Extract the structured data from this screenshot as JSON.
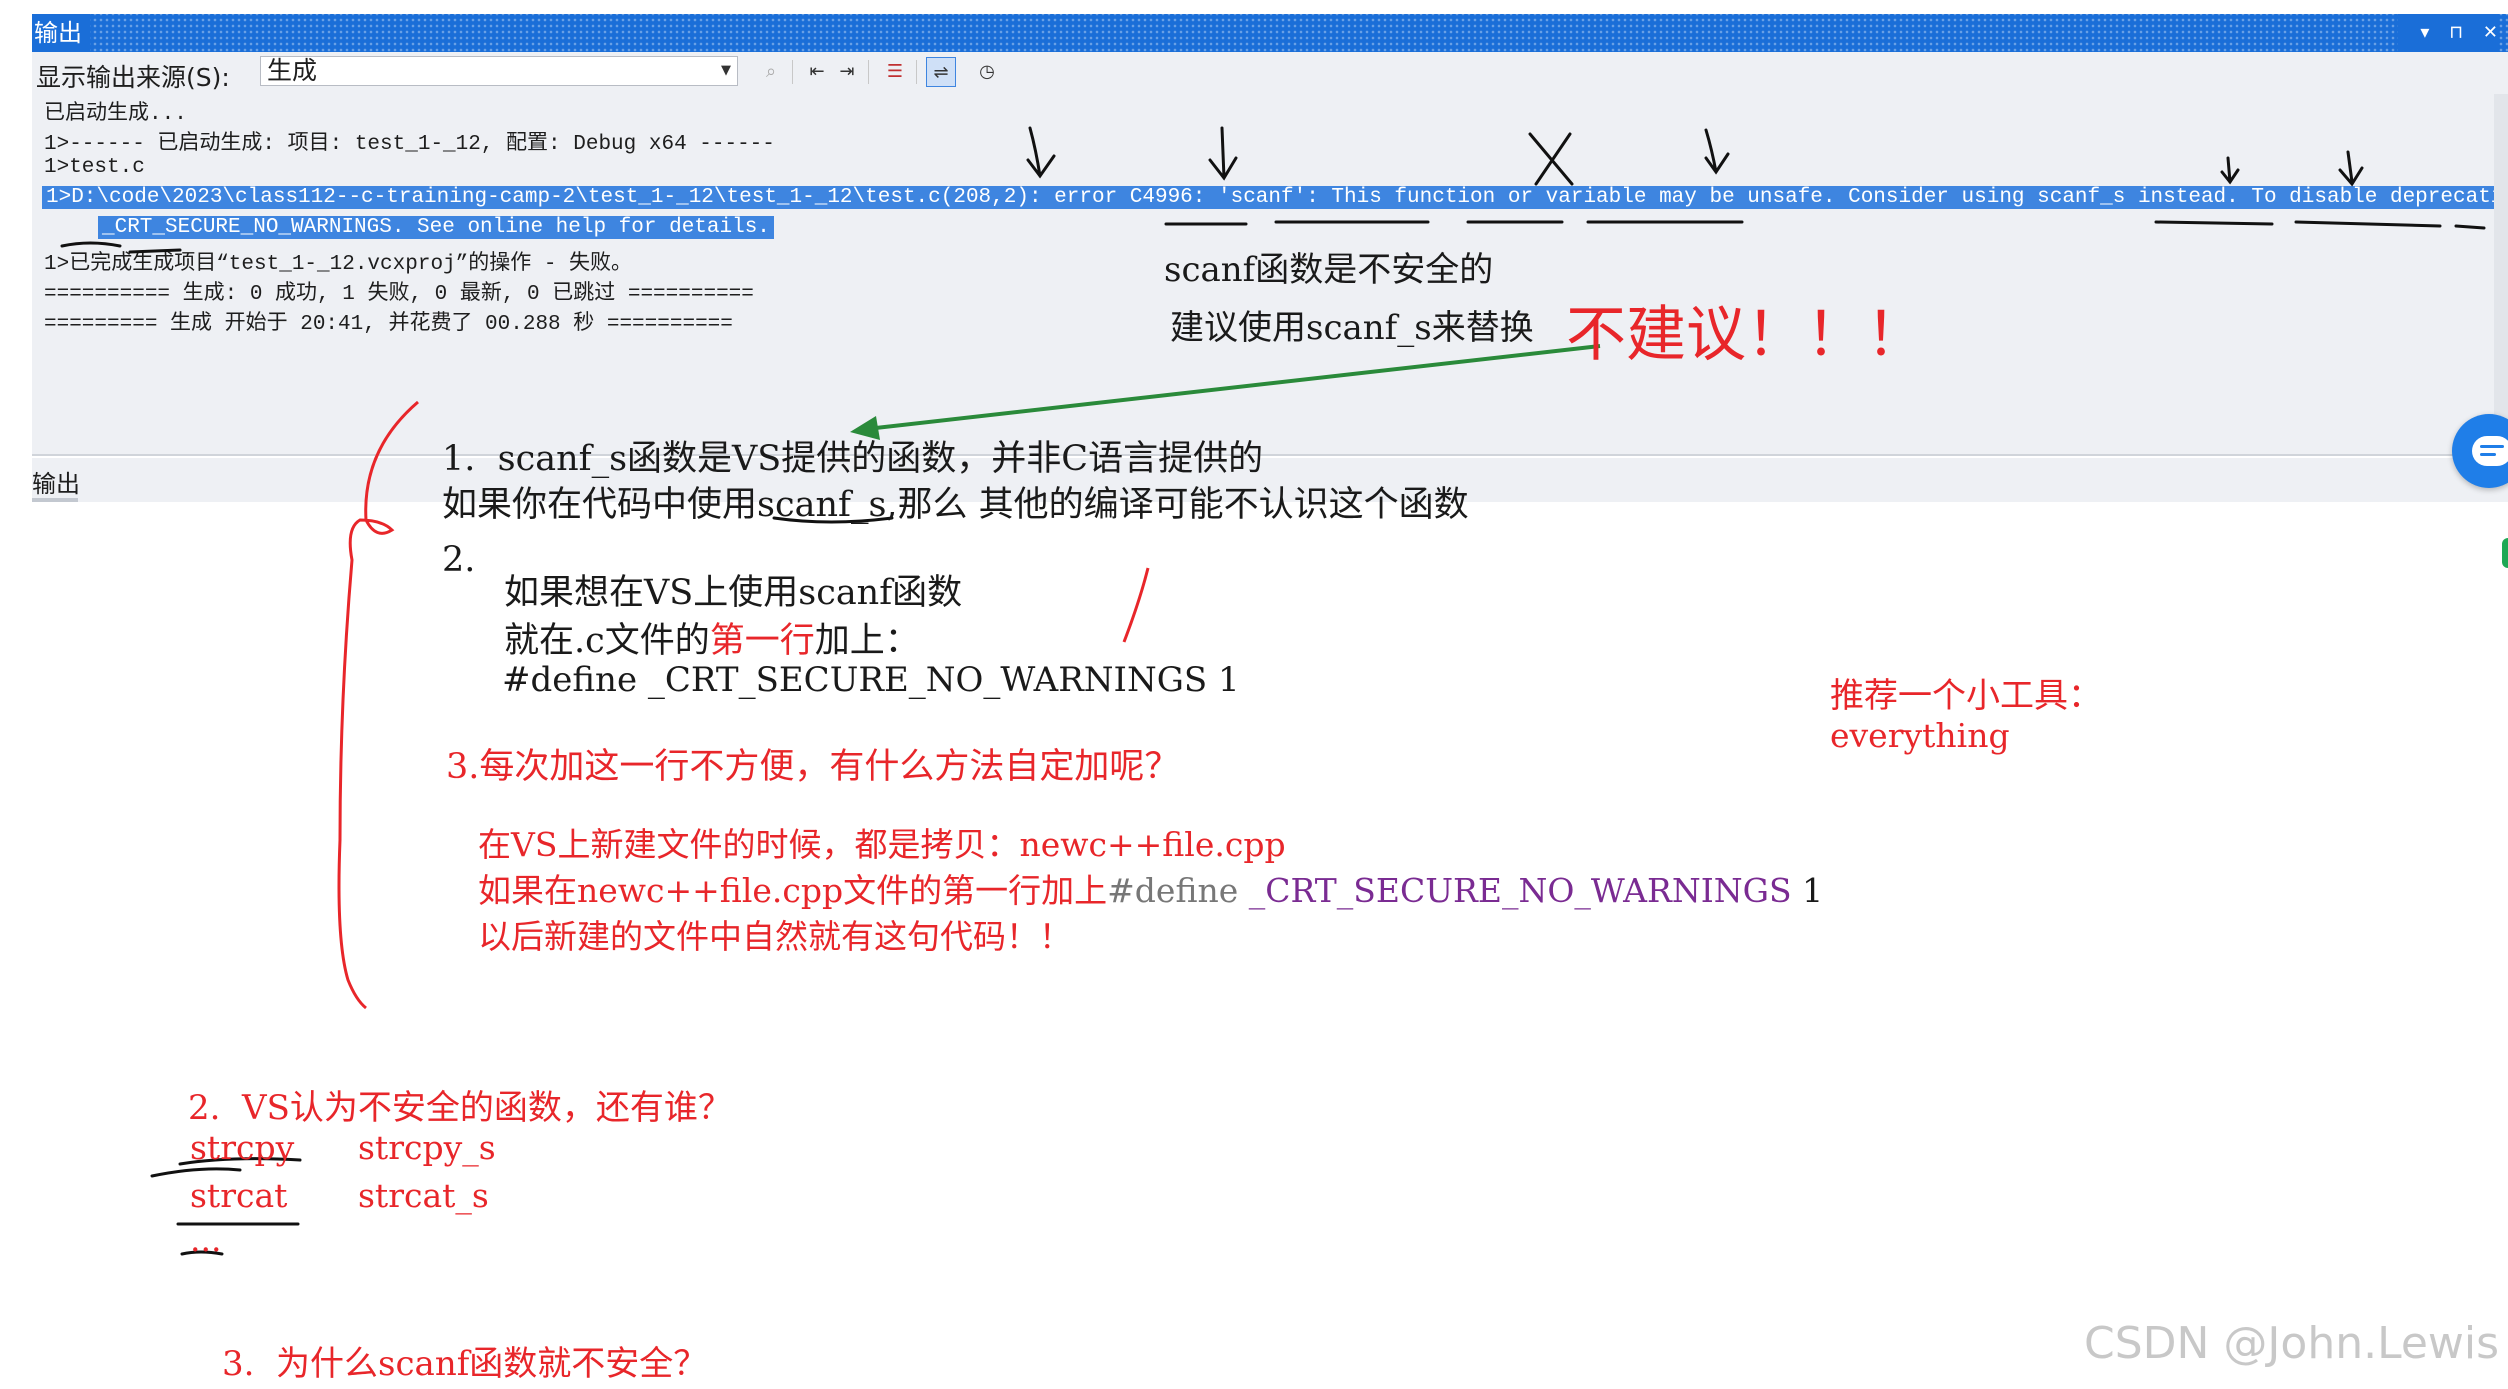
{
  "window": {
    "title": "输出",
    "controls": [
      "▾",
      "⊓",
      "✕"
    ]
  },
  "toolbar": {
    "source_label": "显示输出来源(S):",
    "source_value": "生成",
    "buttons": [
      {
        "icon": "find-message-icon",
        "glyph": "⌕"
      },
      {
        "icon": "prev-message-icon",
        "glyph": "⇤"
      },
      {
        "icon": "next-message-icon",
        "glyph": "⇥"
      },
      {
        "icon": "clear-all-icon",
        "glyph": "☰"
      },
      {
        "icon": "word-wrap-icon",
        "glyph": "⇌"
      },
      {
        "icon": "clock-icon",
        "glyph": "◷"
      }
    ]
  },
  "log": {
    "lines": [
      "已启动生成...",
      "1>------ 已启动生成: 项目: test_1-_12, 配置: Debug x64 ------",
      "1>test.c",
      "1>D:\\code\\2023\\class112--c-training-camp-2\\test_1-_12\\test_1-_12\\test.c(208,2): error C4996: 'scanf': This function or variable may be unsafe. Consider using scanf_s instead. To disable deprecation, use",
      "_CRT_SECURE_NO_WARNINGS. See online help for details.",
      "1>已完成生成项目“test_1-_12.vcxproj”的操作 - 失败。",
      "========== 生成: 0 成功, 1 失败, 0 最新, 0 已跳过 ==========",
      "========= 生成 开始于 20:41, 并花费了 00.288 秒 =========="
    ]
  },
  "bottom_tab": {
    "label": "输出"
  },
  "annotations": {
    "scanf_unsafe": "scanf函数是不安全的",
    "suggest_scanf_s": "建议使用scanf_s来替换",
    "not_recommended": "不建议！！！",
    "item1_line1": "1.  scanf_s函数是VS提供的函数，并非C语言提供的",
    "item1_line2a": "如果你在代码中使用",
    "item1_line2b": "scanf_s",
    "item1_line2c": ",那么 其他的编译可能不认识这个函数",
    "item2_num": "2.",
    "item2_line1": "如果想在VS上使用scanf函数",
    "item2_line2a": "就在.c文件的",
    "item2_line2b": "第一行",
    "item2_line2c": "加上：",
    "item2_define": "#define _CRT_SECURE_NO_WARNINGS 1",
    "item3": "3.每次加这一行不方便，有什么方法自定加呢？",
    "item3_line1": "在VS上新建文件的时候，都是拷贝：newc++file.cpp",
    "item3_line2a": "如果在newc++file.cpp文件的第一行加上",
    "item3_line2b": "#define",
    "item3_line2c": " _CRT_SECURE_NO_WARNINGS",
    "item3_line2d": " 1",
    "item3_line3": "以后新建的文件中自然就有这句代码！！",
    "tool_title": "推荐一个小工具：",
    "tool_name": "everything",
    "q2": "2.  VS认为不安全的函数，还有谁？",
    "q2_row1a": "strcpy",
    "q2_row1b": "strcpy_s",
    "q2_row2a": "strcat",
    "q2_row2b": "strcat_s",
    "q2_more": "...",
    "q3": "3.  为什么scanf函数就不安全？"
  },
  "watermark": "CSDN @John.Lewis",
  "colors": {
    "titlebar": "#1a6ed8",
    "panel": "#eef0f4",
    "selection": "#3e85e0",
    "annotation_red": "#e8262a",
    "arrow_green": "#2a8a3a",
    "define_purple": "#7a2b92"
  }
}
